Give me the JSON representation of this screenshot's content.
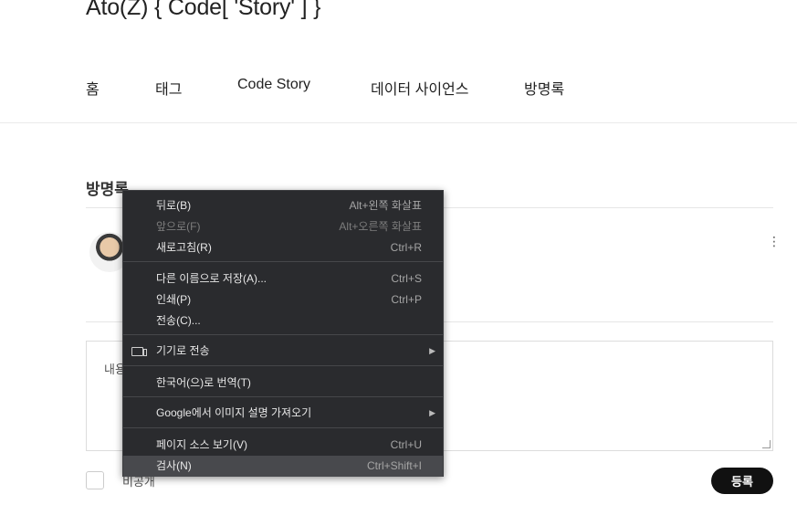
{
  "site": {
    "title": "Ato(Z) { Code[ 'Story' ] }"
  },
  "nav": [
    "홈",
    "태그",
    "Code Story",
    "데이터 사이언스",
    "방명록"
  ],
  "guestbook": {
    "section_title": "방명록",
    "placeholder": "내용을 입력하세요",
    "visible_placeholder_fragment": "내용",
    "secret_label": "비공개",
    "submit_label": "등록",
    "more_icon": "⋮"
  },
  "context_menu": {
    "items": [
      {
        "label": "뒤로(B)",
        "shortcut": "Alt+왼쪽 화살표",
        "disabled": false
      },
      {
        "label": "앞으로(F)",
        "shortcut": "Alt+오른쪽 화살표",
        "disabled": true
      },
      {
        "label": "새로고침(R)",
        "shortcut": "Ctrl+R",
        "disabled": false
      },
      {
        "label": "다른 이름으로 저장(A)...",
        "shortcut": "Ctrl+S",
        "disabled": false
      },
      {
        "label": "인쇄(P)",
        "shortcut": "Ctrl+P",
        "disabled": false
      },
      {
        "label": "전송(C)...",
        "shortcut": "",
        "disabled": false
      },
      {
        "label": "기기로 전송",
        "shortcut": "",
        "submenu": true,
        "icon": "cast-device-icon"
      },
      {
        "label": "한국어(으)로 번역(T)",
        "shortcut": ""
      },
      {
        "label": "Google에서 이미지 설명 가져오기",
        "shortcut": "",
        "submenu": true
      },
      {
        "label": "페이지 소스 보기(V)",
        "shortcut": "Ctrl+U"
      },
      {
        "label": "검사(N)",
        "shortcut": "Ctrl+Shift+I",
        "highlighted": true
      }
    ]
  },
  "colors": {
    "menu_bg": "#2a2b2e",
    "menu_hover": "#48494d",
    "button_bg": "#111111"
  }
}
